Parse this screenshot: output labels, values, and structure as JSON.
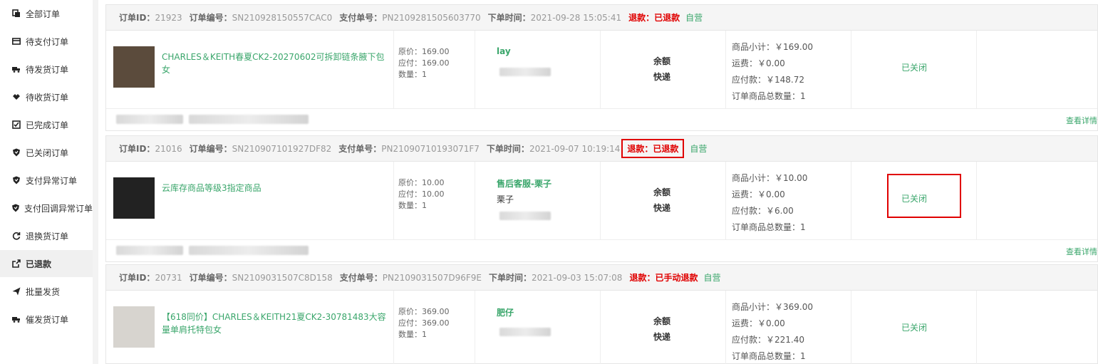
{
  "sidebar": {
    "items": [
      {
        "label": "全部订单",
        "icon": "copy-icon"
      },
      {
        "label": "待支付订单",
        "icon": "card-icon"
      },
      {
        "label": "待发货订单",
        "icon": "truck-icon"
      },
      {
        "label": "待收货订单",
        "icon": "handshake-icon"
      },
      {
        "label": "已完成订单",
        "icon": "check-square-icon"
      },
      {
        "label": "已关闭订单",
        "icon": "shield-icon"
      },
      {
        "label": "支付异常订单",
        "icon": "shield-icon"
      },
      {
        "label": "支付回调异常订单",
        "icon": "shield-icon"
      },
      {
        "label": "退换货订单",
        "icon": "refresh-icon"
      },
      {
        "label": "已退款",
        "icon": "share-icon"
      },
      {
        "label": "批量发货",
        "icon": "send-icon"
      },
      {
        "label": "催发货订单",
        "icon": "truck-icon"
      }
    ],
    "active_index": 9
  },
  "labels": {
    "order_id": "订单ID：",
    "order_no": "订单编号：",
    "pay_no": "支付单号：",
    "time": "下单时间：",
    "detail": "查看详情"
  },
  "orders": [
    {
      "id": "21923",
      "order_no": "SN210928150557CAC0",
      "pay_no": "PN2109281505603770",
      "time": "2021-09-28 15:05:41",
      "refund": "退款：已退款",
      "self": "自营",
      "product": "CHARLES＆KEITH春夏CK2-20270602可拆卸链条腋下包女",
      "original_price": "原价：169.00",
      "payable_price": "应付：169.00",
      "qty": "数量：1",
      "buyer": "lay",
      "buyer2": "",
      "pay_method": "余额",
      "delivery": "快递",
      "subtotal": "商品小计：￥169.00",
      "shipping": "运费：￥0.00",
      "payable": "应付款：￥148.72",
      "total_qty": "订单商品总数量：1",
      "status": "已关闭",
      "thumb_color": "#5b4b3c"
    },
    {
      "id": "21016",
      "order_no": "SN210907101927DF82",
      "pay_no": "PN21090710193071F7",
      "time": "2021-09-07 10:19:14",
      "refund": "退款：已退款",
      "self": "自营",
      "product": "云库存商品等级3指定商品",
      "original_price": "原价：10.00",
      "payable_price": "应付：10.00",
      "qty": "数量：1",
      "buyer": "售后客服-栗子",
      "buyer2": "栗子",
      "pay_method": "余额",
      "delivery": "快递",
      "subtotal": "商品小计：￥10.00",
      "shipping": "运费：￥0.00",
      "payable": "应付款：￥6.00",
      "total_qty": "订单商品总数量：1",
      "status": "已关闭",
      "thumb_color": "#222222"
    },
    {
      "id": "20731",
      "order_no": "SN2109031507C8D158",
      "pay_no": "PN2109031507D96F9E",
      "time": "2021-09-03 15:07:08",
      "refund": "退款：已手动退款",
      "self": "自营",
      "product": "【618同价】CHARLES＆KEITH21夏CK2-30781483大容量单肩托特包女",
      "original_price": "原价：369.00",
      "payable_price": "应付：369.00",
      "qty": "数量：1",
      "buyer": "肥仔",
      "buyer2": "",
      "pay_method": "余额",
      "delivery": "快递",
      "subtotal": "商品小计：￥369.00",
      "shipping": "运费：￥0.00",
      "payable": "应付款：￥221.40",
      "total_qty": "订单商品总数量：1",
      "status": "已关闭",
      "thumb_color": "#d7d4cf"
    }
  ]
}
